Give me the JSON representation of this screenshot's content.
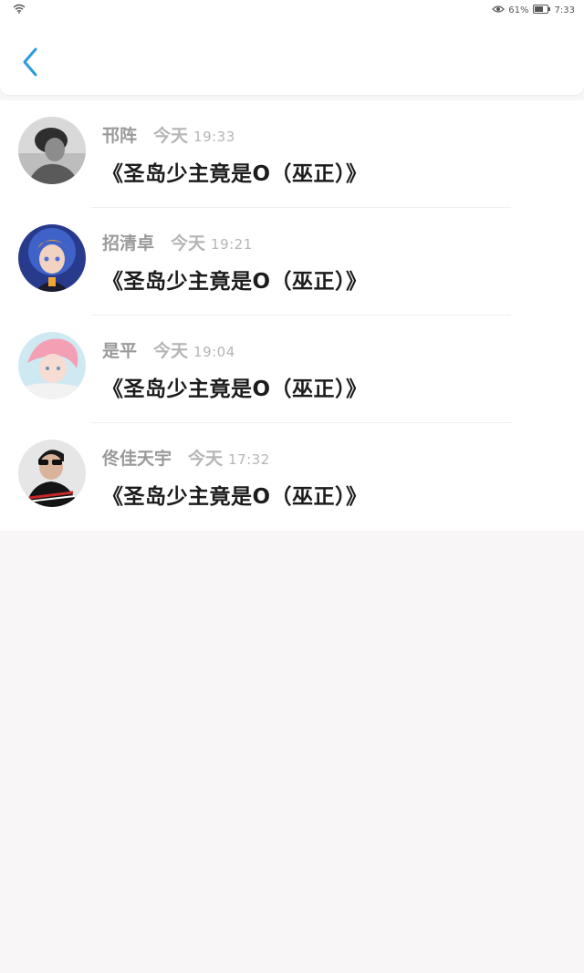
{
  "status_bar": {
    "battery_percent": "61%",
    "clock": "7:33",
    "icons": [
      "wifi-icon",
      "eye-icon",
      "battery-icon"
    ]
  },
  "header": {
    "back_icon": "chevron-left-icon",
    "accent_color": "#2b9be0"
  },
  "comments": [
    {
      "author": "邗阵",
      "day": "今天",
      "time": "19:33",
      "text": "《圣岛少主竟是O（巫正）》"
    },
    {
      "author": "招清卓",
      "day": "今天",
      "time": "19:21",
      "text": "《圣岛少主竟是O（巫正）》"
    },
    {
      "author": "是平",
      "day": "今天",
      "time": "19:04",
      "text": "《圣岛少主竟是O（巫正）》"
    },
    {
      "author": "佟佳天宇",
      "day": "今天",
      "time": "17:32",
      "text": "《圣岛少主竟是O（巫正）》"
    }
  ]
}
